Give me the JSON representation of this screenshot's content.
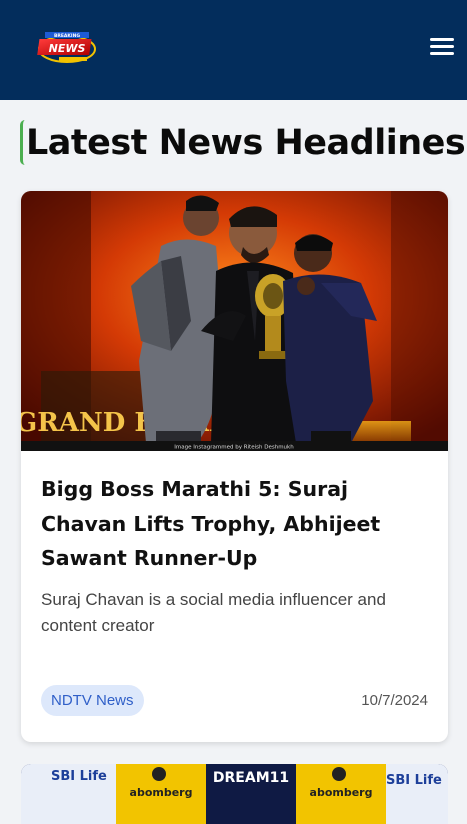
{
  "header": {
    "logo_text": "NEWS",
    "logo_sub": "BREAKING",
    "menu_icon": "hamburger-menu-icon"
  },
  "page": {
    "title": "Latest News Headlines"
  },
  "articles": [
    {
      "headline": "Bigg Boss Marathi 5: Suraj Chavan Lifts Trophy, Abhijeet Sawant Runner-Up",
      "description": "Suraj Chavan is a social media influencer and content creator",
      "source": "NDTV News",
      "date": "10/7/2024",
      "image_caption": "Image Instagrammed by Riteish Deshmukh",
      "image_stage_text": "GRAND FINALE"
    },
    {
      "image_banner_labels": [
        "SBI Life",
        "abomberg",
        "DREAM11",
        "abomberg",
        "SBI Life"
      ]
    }
  ],
  "colors": {
    "header_bg": "#032d5c",
    "accent_bar": "#4caf50",
    "badge_bg": "#dde8fb",
    "badge_text": "#2f5fc8"
  }
}
